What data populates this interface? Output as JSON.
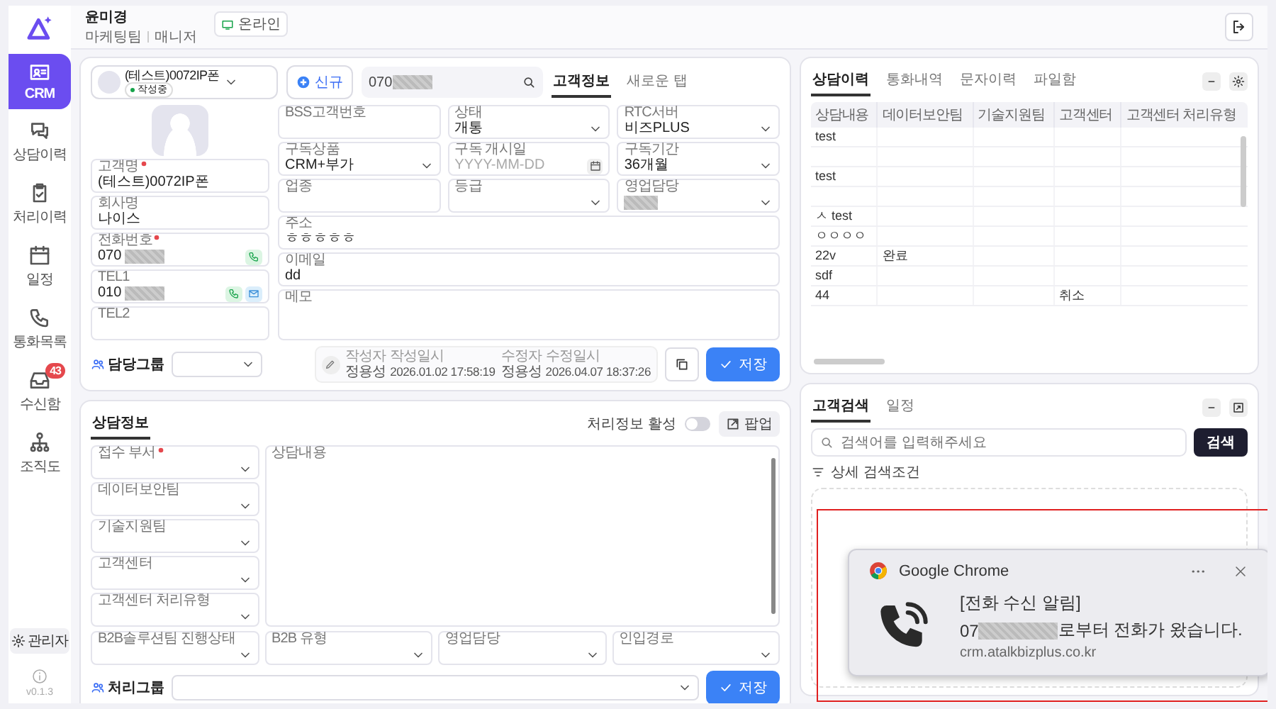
{
  "header": {
    "name": "윤미경",
    "team": "마케팅팀",
    "role": "매니저",
    "status": "온라인"
  },
  "sidebar": {
    "items": [
      {
        "label": "CRM",
        "selected": true
      },
      {
        "label": "상담이력",
        "selected": false
      },
      {
        "label": "처리이력",
        "selected": false
      },
      {
        "label": "일정",
        "selected": false
      },
      {
        "label": "통화목록",
        "selected": false
      },
      {
        "label": "수신함",
        "selected": false,
        "badge": "43"
      },
      {
        "label": "조직도",
        "selected": false
      }
    ],
    "admin": "관리자",
    "version": "v0.1.3"
  },
  "customer_panel": {
    "customer": {
      "name": "(테스트)0072IP폰",
      "status": "작성중"
    },
    "new_button": "신규",
    "phone_search": {
      "value": "070",
      "masked": true
    },
    "tabs": [
      {
        "label": "고객정보",
        "selected": true
      },
      {
        "label": "새로운 탭",
        "selected": false
      }
    ],
    "left_fields": [
      {
        "label": "고객명",
        "required": true,
        "masked": false,
        "call": false,
        "mail": false,
        "value": "(테스트)0072IP폰"
      },
      {
        "label": "회사명",
        "required": false,
        "masked": false,
        "call": false,
        "mail": false,
        "value": "나이스"
      },
      {
        "label": "전화번호",
        "required": true,
        "masked": true,
        "call": true,
        "mail": false,
        "value": "070"
      },
      {
        "label": "TEL1",
        "required": false,
        "masked": true,
        "call": true,
        "mail": true,
        "value": "010"
      },
      {
        "label": "TEL2",
        "required": false,
        "masked": false,
        "call": false,
        "mail": false
      }
    ],
    "fields": [
      {
        "label": "BSS고객번호",
        "kind": "text",
        "masked": false
      },
      {
        "label": "상태",
        "kind": "select",
        "masked": false,
        "value": "개통"
      },
      {
        "label": "RTC서버",
        "kind": "select",
        "masked": false,
        "value": "비즈PLUS"
      },
      {
        "label": "구독상품",
        "kind": "select",
        "masked": false,
        "value": "CRM+부가"
      },
      {
        "label": "구독 개시일",
        "kind": "date",
        "masked": false,
        "placeholder": "YYYY-MM-DD"
      },
      {
        "label": "구독기간",
        "kind": "select",
        "masked": false,
        "value": "36개월"
      },
      {
        "label": "업종",
        "kind": "text",
        "masked": false
      },
      {
        "label": "등급",
        "kind": "select",
        "masked": false
      },
      {
        "label": "영업담당",
        "kind": "select",
        "masked": true
      },
      {
        "label": "주소",
        "kind": "wide",
        "masked": false,
        "value": "ㅎㅎㅎㅎㅎ"
      },
      {
        "label": "이메일",
        "kind": "wide",
        "masked": false,
        "value": "dd"
      },
      {
        "label": "메모",
        "kind": "memo",
        "masked": false
      }
    ],
    "group_label": "담당그룹",
    "audit": [
      {
        "who_label": "작성자",
        "when_label": "작성일시",
        "who": "정용성",
        "when": "2026.01.02 17:58:19"
      },
      {
        "who_label": "수정자",
        "when_label": "수정일시",
        "who": "정용성",
        "when": "2026.04.07 18:37:26"
      }
    ],
    "save": "저장"
  },
  "counsel_panel": {
    "tab": "상담정보",
    "toggle": {
      "label": "처리정보 활성",
      "on": false
    },
    "popup_button": "팝업",
    "side_fields": [
      {
        "label": "접수 부서",
        "required": true
      },
      {
        "label": "데이터보안팀",
        "required": false
      },
      {
        "label": "기술지원팀",
        "required": false
      },
      {
        "label": "고객센터",
        "required": false
      },
      {
        "label": "고객센터 처리유형",
        "required": false
      }
    ],
    "content_label": "상담내용",
    "bottom_fields": [
      {
        "label": "B2B솔루션팀 진행상태"
      },
      {
        "label": "B2B 유형"
      },
      {
        "label": "영업담당"
      },
      {
        "label": "인입경로"
      }
    ],
    "group_label": "처리그룹",
    "save": "저장"
  },
  "history_panel": {
    "tabs": [
      {
        "label": "상담이력",
        "selected": true
      },
      {
        "label": "통화내역",
        "selected": false
      },
      {
        "label": "문자이력",
        "selected": false
      },
      {
        "label": "파일함",
        "selected": false
      }
    ],
    "columns": [
      "상담내용",
      "데이터보안팀",
      "기술지원팀",
      "고객센터",
      "고객센터 처리유형"
    ],
    "rows": [
      [
        "test",
        null,
        null,
        null,
        null
      ],
      [
        null,
        null,
        null,
        null,
        null
      ],
      [
        "test",
        null,
        null,
        null,
        null
      ],
      [
        null,
        null,
        null,
        null,
        null
      ],
      [
        "ㅅ test",
        null,
        null,
        null,
        null
      ],
      [
        "ㅇㅇㅇㅇ",
        null,
        null,
        null,
        null
      ],
      [
        "22v",
        "완료",
        null,
        null,
        null
      ],
      [
        "sdf",
        null,
        null,
        null,
        null
      ],
      [
        "44",
        null,
        null,
        "취소",
        null
      ]
    ]
  },
  "search_panel": {
    "tabs": [
      {
        "label": "고객검색",
        "selected": true
      },
      {
        "label": "일정",
        "selected": false
      }
    ],
    "placeholder": "검색어를 입력해주세요",
    "button": "검색",
    "filter": "상세 검색조건"
  },
  "notification": {
    "app": "Google Chrome",
    "title": "[전화 수신 알림]",
    "message_prefix": "07",
    "masked": true,
    "message_suffix": "로부터 전화가 왔습니다.",
    "source": "crm.atalkbizplus.co.kr",
    "highlighted": true
  }
}
